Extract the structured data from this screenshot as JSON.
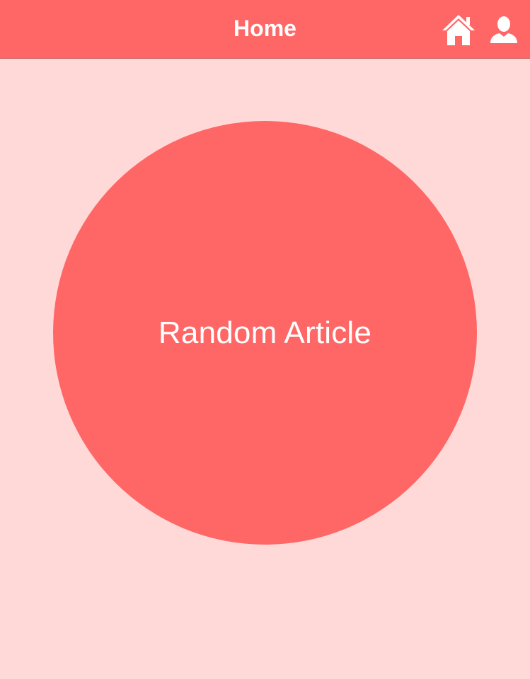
{
  "navbar": {
    "title": "Home",
    "background_color": "#FF6767",
    "icons": {
      "home": "home-icon",
      "profile": "user-icon"
    }
  },
  "main": {
    "background_color": "#FFD9D8",
    "random_button": {
      "label": "Random Article",
      "color": "#FF6767"
    }
  }
}
